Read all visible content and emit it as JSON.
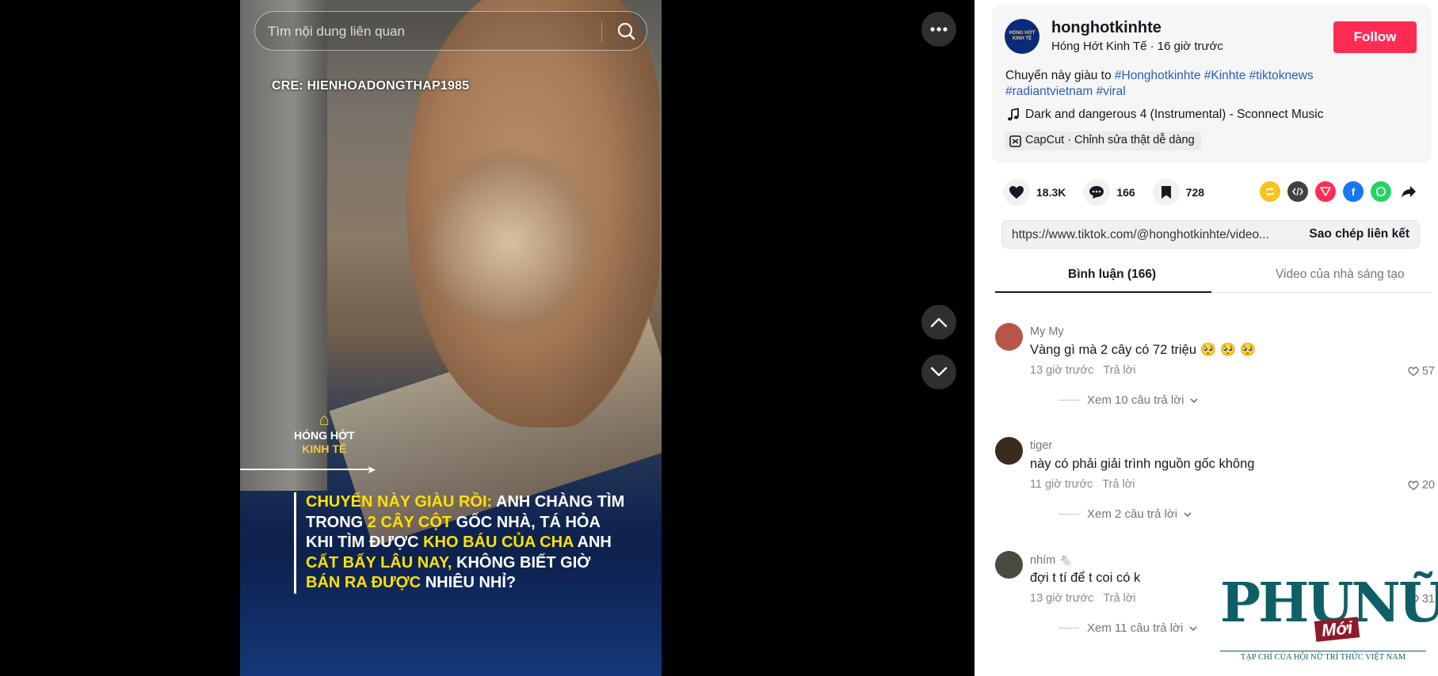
{
  "video": {
    "search_placeholder": "Tìm nội dung liên quan",
    "credit": "CRE: HIENHOADONGTHAP1985",
    "brand_line1": "HÓNG HỚT",
    "brand_line2": "KINH TẾ",
    "headline": [
      {
        "text": "CHUYẾN NÀY GIÀU RỒI:",
        "hl": true
      },
      {
        "text": " ANH CHÀNG TÌM TRONG ",
        "hl": false
      },
      {
        "text": "2 CÂY CỘT",
        "hl": true
      },
      {
        "text": " GỐC NHÀ, TÁ HỎA KHI TÌM ĐƯỢC ",
        "hl": false
      },
      {
        "text": "KHO BÁU CỦA CHA",
        "hl": true
      },
      {
        "text": " ANH ",
        "hl": false
      },
      {
        "text": "CẤT BẤY LÂU NAY,",
        "hl": true
      },
      {
        "text": " KHÔNG BIẾT GIỜ ",
        "hl": false
      },
      {
        "text": "BÁN RA ĐƯỢC",
        "hl": true
      },
      {
        "text": " NHIÊU NHỈ?",
        "hl": false
      }
    ]
  },
  "post": {
    "username": "honghotkinhte",
    "meta": "Hóng Hớt Kinh Tế · 16 giờ trước",
    "follow_label": "Follow",
    "caption": "Chuyến này giàu to ",
    "hashtags": [
      "#Honghotkinhte",
      "#Kinhte",
      "#tiktoknews",
      "#radiantvietnam",
      "#viral"
    ],
    "music": "Dark and dangerous 4 (Instrumental) - Sconnect Music",
    "capcut": "CapCut · Chỉnh sửa thật dễ dàng",
    "likes": "18.3K",
    "comments": "166",
    "saves": "728",
    "link": "https://www.tiktok.com/@honghotkinhte/video...",
    "copy_label": "Sao chép liên kết"
  },
  "tabs": {
    "comments": "Bình luận (166)",
    "creator_videos": "Video của nhà sáng tạo"
  },
  "comments": [
    {
      "name": "My My",
      "text": "Vàng gì mà 2 cây có 72 triệu 🥺 🥺 🥺",
      "time": "13 giờ trước",
      "reply": "Trả lời",
      "likes": "57",
      "more": "Xem 10 câu trả lời",
      "avatar_color": "#b8554a"
    },
    {
      "name": "tiger",
      "text": "này có phải giải trình nguồn gốc không",
      "time": "11 giờ trước",
      "reply": "Trả lời",
      "likes": "20",
      "more": "Xem 2 câu trả lời",
      "avatar_color": "#3b2a1e"
    },
    {
      "name": "nhím 🐁",
      "text": "đợi t tí để t coi có k",
      "time": "13 giờ trước",
      "reply": "Trả lời",
      "likes": "31",
      "more": "Xem 11 câu trả lời",
      "avatar_color": "#4a4a40"
    }
  ],
  "watermark": {
    "logo": "PHỤNỮ",
    "moi": "Mới",
    "tagline": "TẠP CHÍ CỦA HỘI NỮ TRÍ THỨC VIỆT NAM"
  }
}
